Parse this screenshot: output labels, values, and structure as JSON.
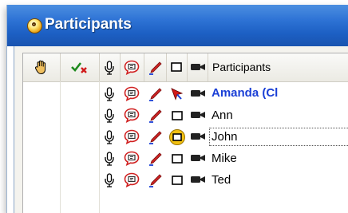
{
  "window": {
    "title": "Participants"
  },
  "columns": {
    "hand": "raise-hand-icon",
    "check": "approve-deny-icon",
    "mic": "microphone-icon",
    "chat": "chat-bubble-icon",
    "pen": "annotate-pen-icon",
    "whiteboard": "whiteboard-icon",
    "camera": "video-camera-icon",
    "participants_label": "Participants"
  },
  "participants": [
    {
      "name": "Amanda (Cl",
      "is_host": true,
      "pointer": "presenter-pointer-icon"
    },
    {
      "name": "Ann"
    },
    {
      "name": "John",
      "whiteboard_active": true,
      "selected": true
    },
    {
      "name": "Mike"
    },
    {
      "name": "Ted"
    }
  ],
  "colors": {
    "title_bar": "#2f74d6",
    "host_name": "#1a3fd6",
    "pen_red": "#cc2222",
    "chat_red": "#d02020"
  }
}
